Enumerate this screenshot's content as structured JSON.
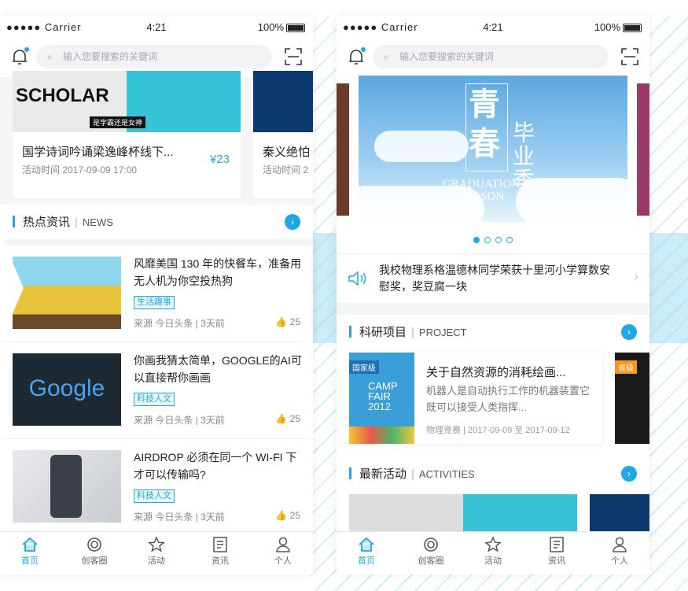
{
  "status": {
    "carrier": "●●●●● Carrier",
    "time": "4:21",
    "battery": "100%"
  },
  "search": {
    "placeholder": "输入您要搜索的关键词"
  },
  "left": {
    "events": [
      {
        "title": "国学诗词吟诵梁逸峰杯线下...",
        "time": "活动时间 2017-09-09 17:00",
        "price": "¥23",
        "img_text": "SCHOLAR",
        "img_badge": "是学霸还是女神"
      },
      {
        "title": "秦义绝怕",
        "time": "活动时间 2"
      }
    ],
    "hot": {
      "title": "热点资讯",
      "sep": "|",
      "en": "NEWS"
    },
    "news": [
      {
        "title": "风靡美国 130 年的快餐车，准备用无人机为你空投热狗",
        "tag": "生活趣事",
        "meta": "来源 今日头条 | 3天前",
        "likes": "25"
      },
      {
        "title": "你画我猜太简单，GOOGLE的AI可以直接帮你画画",
        "tag": "科技人文",
        "meta": "来源 今日头条 | 3天前",
        "likes": "25",
        "img_text": "Google"
      },
      {
        "title": "AIRDROP 必须在同一个 WI-FI 下才可以传输吗?",
        "tag": "科技人文",
        "meta": "来源 今日头条 | 3天前",
        "likes": "25"
      }
    ]
  },
  "right": {
    "banner": {
      "cn1": "青",
      "cn2": "春",
      "cn3": "毕业季",
      "en1": "GRADUATION",
      "en2": "SEASON"
    },
    "notice": "我校物理系格温德林同学荣获十里河小学算数安慰奖，奖豆腐一块",
    "research": {
      "title": "科研项目",
      "sep": "|",
      "en": "PROJECT"
    },
    "project": {
      "badge": "国家级",
      "img1": "CAMP",
      "img2": "FAIR",
      "img3": "2012",
      "title": "关于自然资源的消耗绘画...",
      "desc": "机器人是自动执行工作的机器装置它既可以接受人类指挥...",
      "meta": "物理竞赛 | 2017-09-09 至 2017-09-12",
      "badge2": "省级"
    },
    "activities": {
      "title": "最新活动",
      "sep": "|",
      "en": "ACTIVITIES"
    }
  },
  "tabs": [
    "首页",
    "创客圈",
    "活动",
    "资讯",
    "个人"
  ]
}
